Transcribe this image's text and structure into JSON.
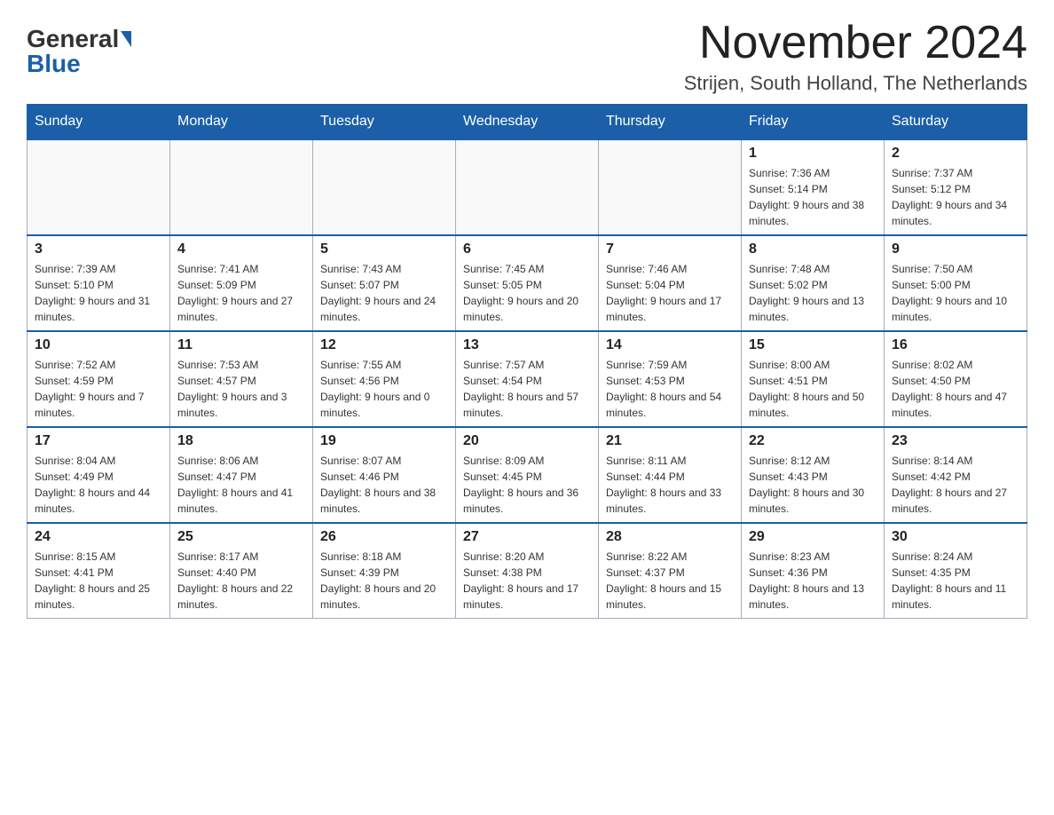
{
  "header": {
    "logo_general": "General",
    "logo_blue": "Blue",
    "month_title": "November 2024",
    "location": "Strijen, South Holland, The Netherlands"
  },
  "weekdays": [
    "Sunday",
    "Monday",
    "Tuesday",
    "Wednesday",
    "Thursday",
    "Friday",
    "Saturday"
  ],
  "weeks": [
    [
      {
        "day": "",
        "info": ""
      },
      {
        "day": "",
        "info": ""
      },
      {
        "day": "",
        "info": ""
      },
      {
        "day": "",
        "info": ""
      },
      {
        "day": "",
        "info": ""
      },
      {
        "day": "1",
        "info": "Sunrise: 7:36 AM\nSunset: 5:14 PM\nDaylight: 9 hours and 38 minutes."
      },
      {
        "day": "2",
        "info": "Sunrise: 7:37 AM\nSunset: 5:12 PM\nDaylight: 9 hours and 34 minutes."
      }
    ],
    [
      {
        "day": "3",
        "info": "Sunrise: 7:39 AM\nSunset: 5:10 PM\nDaylight: 9 hours and 31 minutes."
      },
      {
        "day": "4",
        "info": "Sunrise: 7:41 AM\nSunset: 5:09 PM\nDaylight: 9 hours and 27 minutes."
      },
      {
        "day": "5",
        "info": "Sunrise: 7:43 AM\nSunset: 5:07 PM\nDaylight: 9 hours and 24 minutes."
      },
      {
        "day": "6",
        "info": "Sunrise: 7:45 AM\nSunset: 5:05 PM\nDaylight: 9 hours and 20 minutes."
      },
      {
        "day": "7",
        "info": "Sunrise: 7:46 AM\nSunset: 5:04 PM\nDaylight: 9 hours and 17 minutes."
      },
      {
        "day": "8",
        "info": "Sunrise: 7:48 AM\nSunset: 5:02 PM\nDaylight: 9 hours and 13 minutes."
      },
      {
        "day": "9",
        "info": "Sunrise: 7:50 AM\nSunset: 5:00 PM\nDaylight: 9 hours and 10 minutes."
      }
    ],
    [
      {
        "day": "10",
        "info": "Sunrise: 7:52 AM\nSunset: 4:59 PM\nDaylight: 9 hours and 7 minutes."
      },
      {
        "day": "11",
        "info": "Sunrise: 7:53 AM\nSunset: 4:57 PM\nDaylight: 9 hours and 3 minutes."
      },
      {
        "day": "12",
        "info": "Sunrise: 7:55 AM\nSunset: 4:56 PM\nDaylight: 9 hours and 0 minutes."
      },
      {
        "day": "13",
        "info": "Sunrise: 7:57 AM\nSunset: 4:54 PM\nDaylight: 8 hours and 57 minutes."
      },
      {
        "day": "14",
        "info": "Sunrise: 7:59 AM\nSunset: 4:53 PM\nDaylight: 8 hours and 54 minutes."
      },
      {
        "day": "15",
        "info": "Sunrise: 8:00 AM\nSunset: 4:51 PM\nDaylight: 8 hours and 50 minutes."
      },
      {
        "day": "16",
        "info": "Sunrise: 8:02 AM\nSunset: 4:50 PM\nDaylight: 8 hours and 47 minutes."
      }
    ],
    [
      {
        "day": "17",
        "info": "Sunrise: 8:04 AM\nSunset: 4:49 PM\nDaylight: 8 hours and 44 minutes."
      },
      {
        "day": "18",
        "info": "Sunrise: 8:06 AM\nSunset: 4:47 PM\nDaylight: 8 hours and 41 minutes."
      },
      {
        "day": "19",
        "info": "Sunrise: 8:07 AM\nSunset: 4:46 PM\nDaylight: 8 hours and 38 minutes."
      },
      {
        "day": "20",
        "info": "Sunrise: 8:09 AM\nSunset: 4:45 PM\nDaylight: 8 hours and 36 minutes."
      },
      {
        "day": "21",
        "info": "Sunrise: 8:11 AM\nSunset: 4:44 PM\nDaylight: 8 hours and 33 minutes."
      },
      {
        "day": "22",
        "info": "Sunrise: 8:12 AM\nSunset: 4:43 PM\nDaylight: 8 hours and 30 minutes."
      },
      {
        "day": "23",
        "info": "Sunrise: 8:14 AM\nSunset: 4:42 PM\nDaylight: 8 hours and 27 minutes."
      }
    ],
    [
      {
        "day": "24",
        "info": "Sunrise: 8:15 AM\nSunset: 4:41 PM\nDaylight: 8 hours and 25 minutes."
      },
      {
        "day": "25",
        "info": "Sunrise: 8:17 AM\nSunset: 4:40 PM\nDaylight: 8 hours and 22 minutes."
      },
      {
        "day": "26",
        "info": "Sunrise: 8:18 AM\nSunset: 4:39 PM\nDaylight: 8 hours and 20 minutes."
      },
      {
        "day": "27",
        "info": "Sunrise: 8:20 AM\nSunset: 4:38 PM\nDaylight: 8 hours and 17 minutes."
      },
      {
        "day": "28",
        "info": "Sunrise: 8:22 AM\nSunset: 4:37 PM\nDaylight: 8 hours and 15 minutes."
      },
      {
        "day": "29",
        "info": "Sunrise: 8:23 AM\nSunset: 4:36 PM\nDaylight: 8 hours and 13 minutes."
      },
      {
        "day": "30",
        "info": "Sunrise: 8:24 AM\nSunset: 4:35 PM\nDaylight: 8 hours and 11 minutes."
      }
    ]
  ]
}
